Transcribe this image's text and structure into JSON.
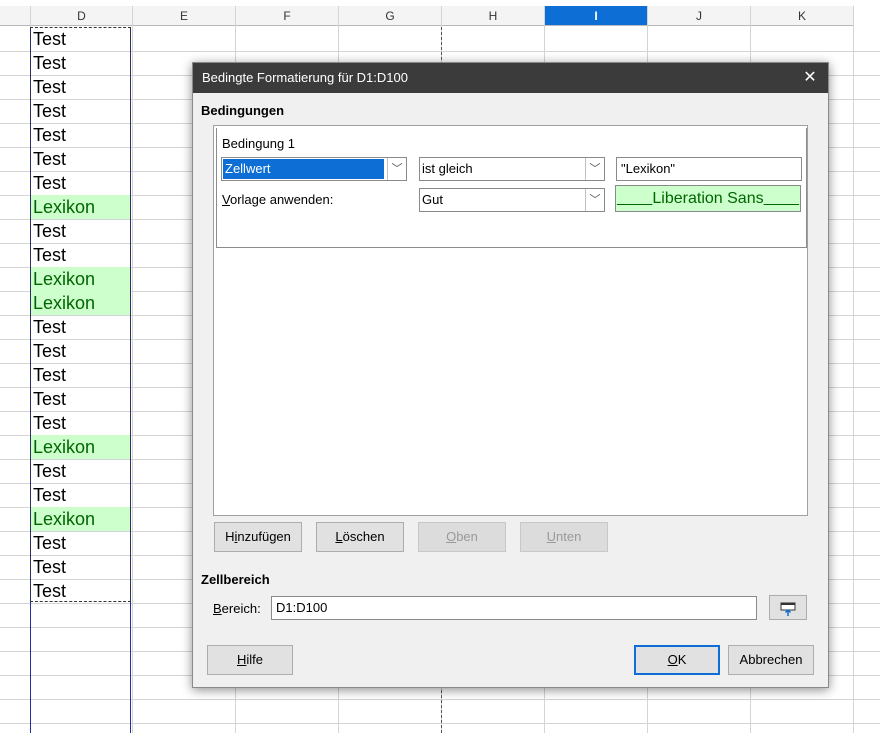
{
  "sheet": {
    "columns": [
      {
        "label": "D",
        "selected": false
      },
      {
        "label": "E",
        "selected": false
      },
      {
        "label": "F",
        "selected": false
      },
      {
        "label": "G",
        "selected": false
      },
      {
        "label": "H",
        "selected": false
      },
      {
        "label": "I",
        "selected": true
      },
      {
        "label": "J",
        "selected": false
      },
      {
        "label": "K",
        "selected": false
      }
    ],
    "cells": [
      "Test",
      "Test",
      "Test",
      "Test",
      "Test",
      "Test",
      "Test",
      "Lexikon",
      "Test",
      "Test",
      "Lexikon",
      "Lexikon",
      "Test",
      "Test",
      "Test",
      "Test",
      "Test",
      "Lexikon",
      "Test",
      "Test",
      "Lexikon",
      "Test",
      "Test",
      "Test"
    ],
    "highlight_value": "Lexikon",
    "highlight_bg": "#ccffcc",
    "highlight_text": "#006600",
    "selection_color": "#0d6fd6"
  },
  "dialog": {
    "title": "Bedingte Formatierung für D1:D100",
    "close_icon": "close-icon",
    "conditions_header": "Bedingungen",
    "condition_label": "Bedingung 1",
    "condition_type": "Zellwert",
    "operator": "ist gleich",
    "value": "\"Lexikon\"",
    "apply_style_label_u": "V",
    "apply_style_label_rest": "orlage anwenden:",
    "style": "Gut",
    "preview_text": "Liberation Sans",
    "buttons": {
      "add_pre": "H",
      "add_u": "i",
      "add_post": "nzufügen",
      "delete_u": "L",
      "delete_post": "öschen",
      "up_u": "O",
      "up_post": "ben",
      "down_u": "U",
      "down_post": "nten"
    },
    "range_header": "Zellbereich",
    "range_label_u": "B",
    "range_label_rest": "ereich:",
    "range_value": "D1:D100",
    "help_u": "H",
    "help_post": "ilfe",
    "ok_u": "O",
    "ok_post": "K",
    "cancel_label": "Abbrechen"
  }
}
